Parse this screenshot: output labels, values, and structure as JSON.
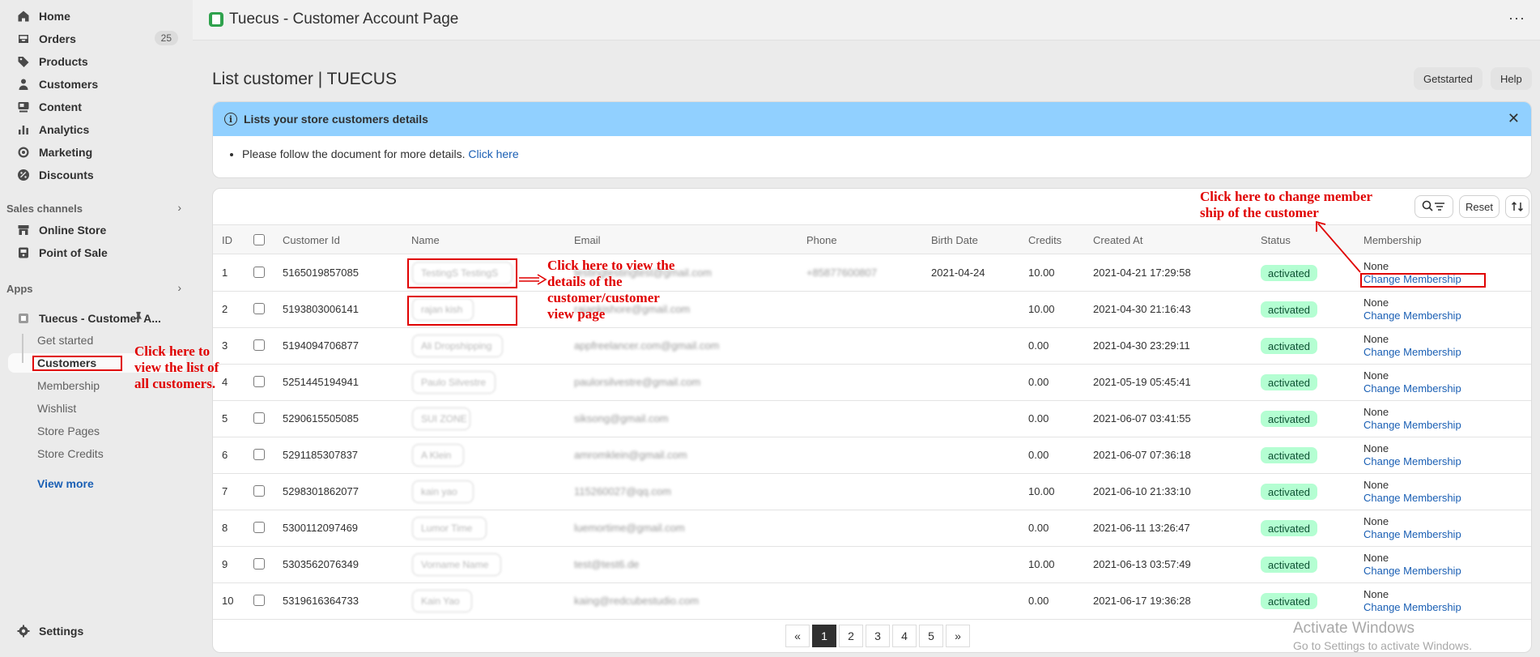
{
  "sidebar": {
    "nav": [
      {
        "label": "Home",
        "icon": "home-icon"
      },
      {
        "label": "Orders",
        "icon": "orders-icon",
        "badge": "25"
      },
      {
        "label": "Products",
        "icon": "tag-icon"
      },
      {
        "label": "Customers",
        "icon": "person-icon"
      },
      {
        "label": "Content",
        "icon": "content-icon"
      },
      {
        "label": "Analytics",
        "icon": "analytics-icon"
      },
      {
        "label": "Marketing",
        "icon": "marketing-icon"
      },
      {
        "label": "Discounts",
        "icon": "discount-icon"
      }
    ],
    "sales_channels_label": "Sales channels",
    "channels": [
      {
        "label": "Online Store",
        "icon": "store-icon"
      },
      {
        "label": "Point of Sale",
        "icon": "pos-icon"
      }
    ],
    "apps_label": "Apps",
    "app_name": "Tuecus - Customer A...",
    "app_subitems": [
      "Get started",
      "Customers",
      "Membership",
      "Wishlist",
      "Store Pages",
      "Store Credits"
    ],
    "view_more": "View more",
    "settings": "Settings"
  },
  "topbar": {
    "title": "Tuecus - Customer Account Page",
    "more": "···"
  },
  "page": {
    "title": "List customer | TUECUS",
    "btn_getstarted": "Getstarted",
    "btn_help": "Help"
  },
  "banner": {
    "title": "Lists your store customers details",
    "body": "Please follow the document for more details.",
    "link": "Click here",
    "close": "✕"
  },
  "toolbar": {
    "reset": "Reset"
  },
  "table": {
    "headers": [
      "ID",
      "Customer Id",
      "Name",
      "Email",
      "Phone",
      "Birth Date",
      "Credits",
      "Created At",
      "Status",
      "Membership"
    ],
    "rows": [
      {
        "id": "1",
        "cid": "5165019857085",
        "name": "TestingS TestingS",
        "email": "testingtestingtest@gmail.com",
        "phone": "+85877600807",
        "birth": "2021-04-24",
        "credits": "10.00",
        "created": "2021-04-21 17:29:58",
        "status": "activated",
        "memb": "None",
        "link": "Change Membership"
      },
      {
        "id": "2",
        "cid": "5193803006141",
        "name": "rajan kish",
        "email": "rajankishore@gmail.com",
        "phone": "",
        "birth": "",
        "credits": "10.00",
        "created": "2021-04-30 21:16:43",
        "status": "activated",
        "memb": "None",
        "link": "Change Membership"
      },
      {
        "id": "3",
        "cid": "5194094706877",
        "name": "Ali Dropshipping",
        "email": "appfreelancer.com@gmail.com",
        "phone": "",
        "birth": "",
        "credits": "0.00",
        "created": "2021-04-30 23:29:11",
        "status": "activated",
        "memb": "None",
        "link": "Change Membership"
      },
      {
        "id": "4",
        "cid": "5251445194941",
        "name": "Paulo Silvestre",
        "email": "paulorsilvestre@gmail.com",
        "phone": "",
        "birth": "",
        "credits": "0.00",
        "created": "2021-05-19 05:45:41",
        "status": "activated",
        "memb": "None",
        "link": "Change Membership"
      },
      {
        "id": "5",
        "cid": "5290615505085",
        "name": "SUI ZONE",
        "email": "siksong@gmail.com",
        "phone": "",
        "birth": "",
        "credits": "0.00",
        "created": "2021-06-07 03:41:55",
        "status": "activated",
        "memb": "None",
        "link": "Change Membership"
      },
      {
        "id": "6",
        "cid": "5291185307837",
        "name": "A Klein",
        "email": "amromklein@gmail.com",
        "phone": "",
        "birth": "",
        "credits": "0.00",
        "created": "2021-06-07 07:36:18",
        "status": "activated",
        "memb": "None",
        "link": "Change Membership"
      },
      {
        "id": "7",
        "cid": "5298301862077",
        "name": "kain yao",
        "email": "115260027@qq.com",
        "phone": "",
        "birth": "",
        "credits": "10.00",
        "created": "2021-06-10 21:33:10",
        "status": "activated",
        "memb": "None",
        "link": "Change Membership"
      },
      {
        "id": "8",
        "cid": "5300112097469",
        "name": "Lumor Time",
        "email": "luemortime@gmail.com",
        "phone": "",
        "birth": "",
        "credits": "0.00",
        "created": "2021-06-11 13:26:47",
        "status": "activated",
        "memb": "None",
        "link": "Change Membership"
      },
      {
        "id": "9",
        "cid": "5303562076349",
        "name": "Vorname Name",
        "email": "test@test6.de",
        "phone": "",
        "birth": "",
        "credits": "10.00",
        "created": "2021-06-13 03:57:49",
        "status": "activated",
        "memb": "None",
        "link": "Change Membership"
      },
      {
        "id": "10",
        "cid": "5319616364733",
        "name": "Kain Yao",
        "email": "kaing@redcubestudio.com",
        "phone": "",
        "birth": "",
        "credits": "0.00",
        "created": "2021-06-17 19:36:28",
        "status": "activated",
        "memb": "None",
        "link": "Change Membership"
      }
    ]
  },
  "pagination": {
    "pages": [
      "«",
      "1",
      "2",
      "3",
      "4",
      "5",
      "»"
    ],
    "current": "1"
  },
  "annotations": {
    "customers_note": [
      "Click here to",
      "view the list of",
      "all customers."
    ],
    "name_note": [
      "Click here to view the",
      "details of the",
      "customer/customer",
      "view page"
    ],
    "membership_note": [
      "Click here to change member",
      "ship of the customer"
    ],
    "color": "#e00000"
  },
  "watermark": {
    "line1": "Activate Windows",
    "line2": "Go to Settings to activate Windows."
  }
}
